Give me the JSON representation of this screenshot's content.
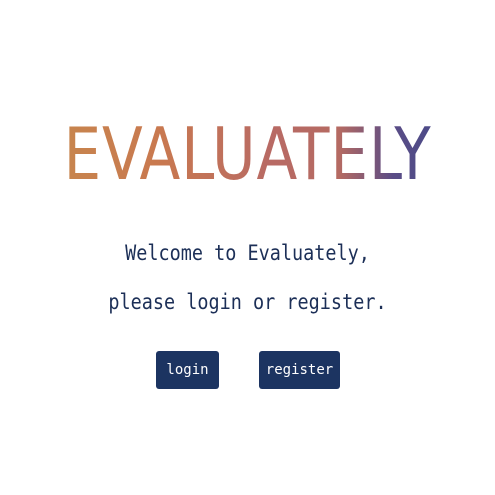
{
  "brand": {
    "logo_text": "EVALUATELY"
  },
  "welcome": {
    "line1": "Welcome to Evaluately,",
    "line2": "please login or register."
  },
  "actions": {
    "login_label": "login",
    "register_label": "register"
  },
  "colors": {
    "text_primary": "#1c2f57",
    "button_bg": "#1c3461",
    "logo_gradient_start": "#c68a4e",
    "logo_gradient_end": "#3d4a8a",
    "background": "#ffffff"
  }
}
